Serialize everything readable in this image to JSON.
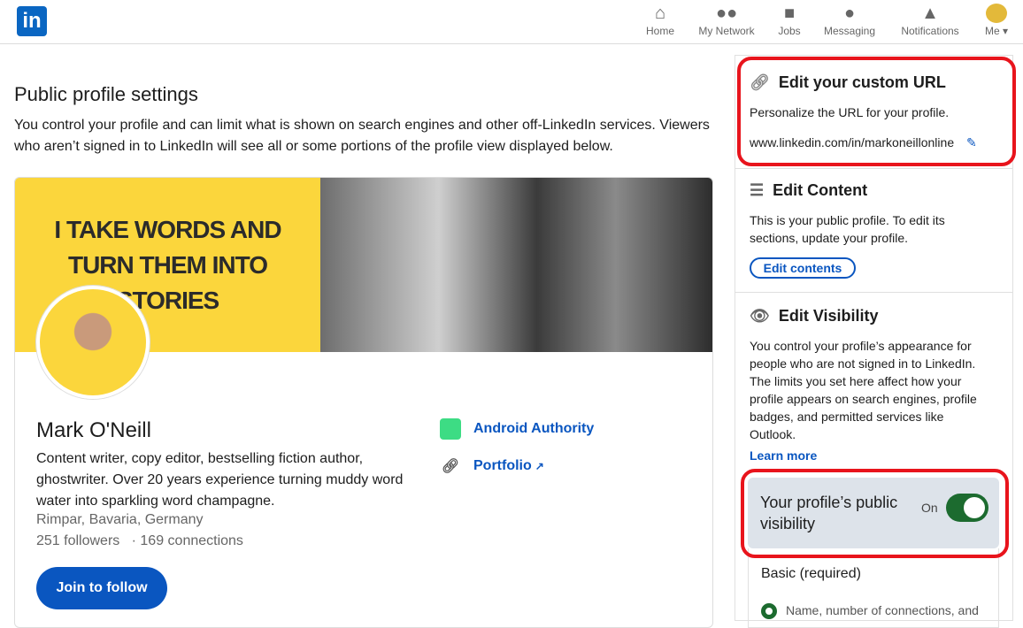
{
  "nav": {
    "logo": "in",
    "items": [
      {
        "label": "Home",
        "icon": "home-icon"
      },
      {
        "label": "My Network",
        "icon": "network-icon"
      },
      {
        "label": "Jobs",
        "icon": "briefcase-icon"
      },
      {
        "label": "Messaging",
        "icon": "message-icon"
      },
      {
        "label": "Notifications",
        "icon": "bell-icon"
      },
      {
        "label": "Me ▾",
        "icon": "avatar"
      }
    ]
  },
  "page": {
    "title": "Public profile settings",
    "description": "You control your profile and can limit what is shown on search engines and other off-LinkedIn services. Viewers who aren’t signed in to LinkedIn will see all or some portions of the profile view displayed below."
  },
  "profile": {
    "banner_text": "I TAKE WORDS AND TURN THEM INTO STORIES",
    "name": "Mark O'Neill",
    "headline": "Content writer, copy editor, bestselling fiction author, ghostwriter. Over 20 years experience turning muddy word water into sparkling word champagne.",
    "location": "Rimpar, Bavaria, Germany",
    "followers": "251 followers",
    "connections": "· 169 connections",
    "join_label": "Join to follow",
    "links": [
      {
        "label": "Android Authority"
      },
      {
        "label": "Portfolio"
      }
    ]
  },
  "sidebar": {
    "url": {
      "title": "Edit your custom URL",
      "text": "Personalize the URL for your profile.",
      "value": "www.linkedin.com/in/markoneillonline"
    },
    "content": {
      "title": "Edit Content",
      "text": "This is your public profile. To edit its sections, update your profile.",
      "button": "Edit contents"
    },
    "visibility": {
      "title": "Edit Visibility",
      "text": "You control your profile’s appearance for people who are not signed in to LinkedIn. The limits you set here affect how your profile appears on search engines, profile badges, and permitted services like Outlook.",
      "learn_more": "Learn more",
      "toggle_label": "Your profile’s public visibility",
      "toggle_state": "On",
      "basic": "Basic (required)",
      "basic_item": "Name, number of connections, and"
    }
  },
  "colors": {
    "accent": "#0a66c2",
    "toggle": "#1c6b2f",
    "highlight": "#e8141c"
  }
}
